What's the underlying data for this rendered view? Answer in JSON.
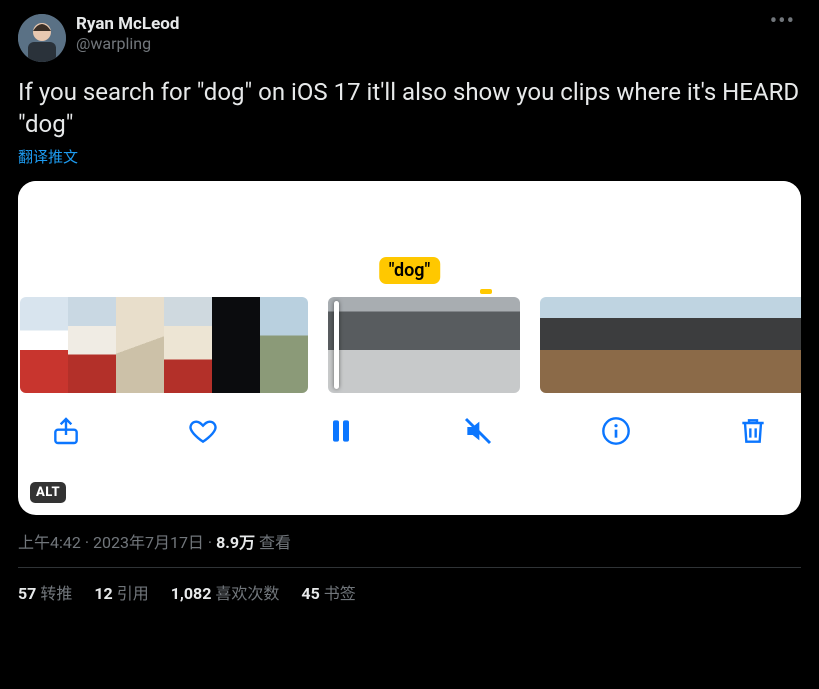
{
  "author": {
    "display_name": "Ryan McLeod",
    "handle": "@warpling"
  },
  "tweet_text": "If you search for \"dog\" on iOS 17 it'll also show you clips where it's HEARD \"dog\"",
  "translate_label": "翻译推文",
  "media": {
    "caption_chip": "\"dog\"",
    "alt_badge": "ALT"
  },
  "meta": {
    "time": "上午4:42",
    "date": "2023年7月17日",
    "sep": " · ",
    "views_number": "8.9万",
    "views_label": " 查看"
  },
  "stats": {
    "retweets": {
      "count": "57",
      "label": "转推"
    },
    "quotes": {
      "count": "12",
      "label": "引用"
    },
    "likes": {
      "count": "1,082",
      "label": "喜欢次数"
    },
    "bookmarks": {
      "count": "45",
      "label": "书签"
    }
  }
}
